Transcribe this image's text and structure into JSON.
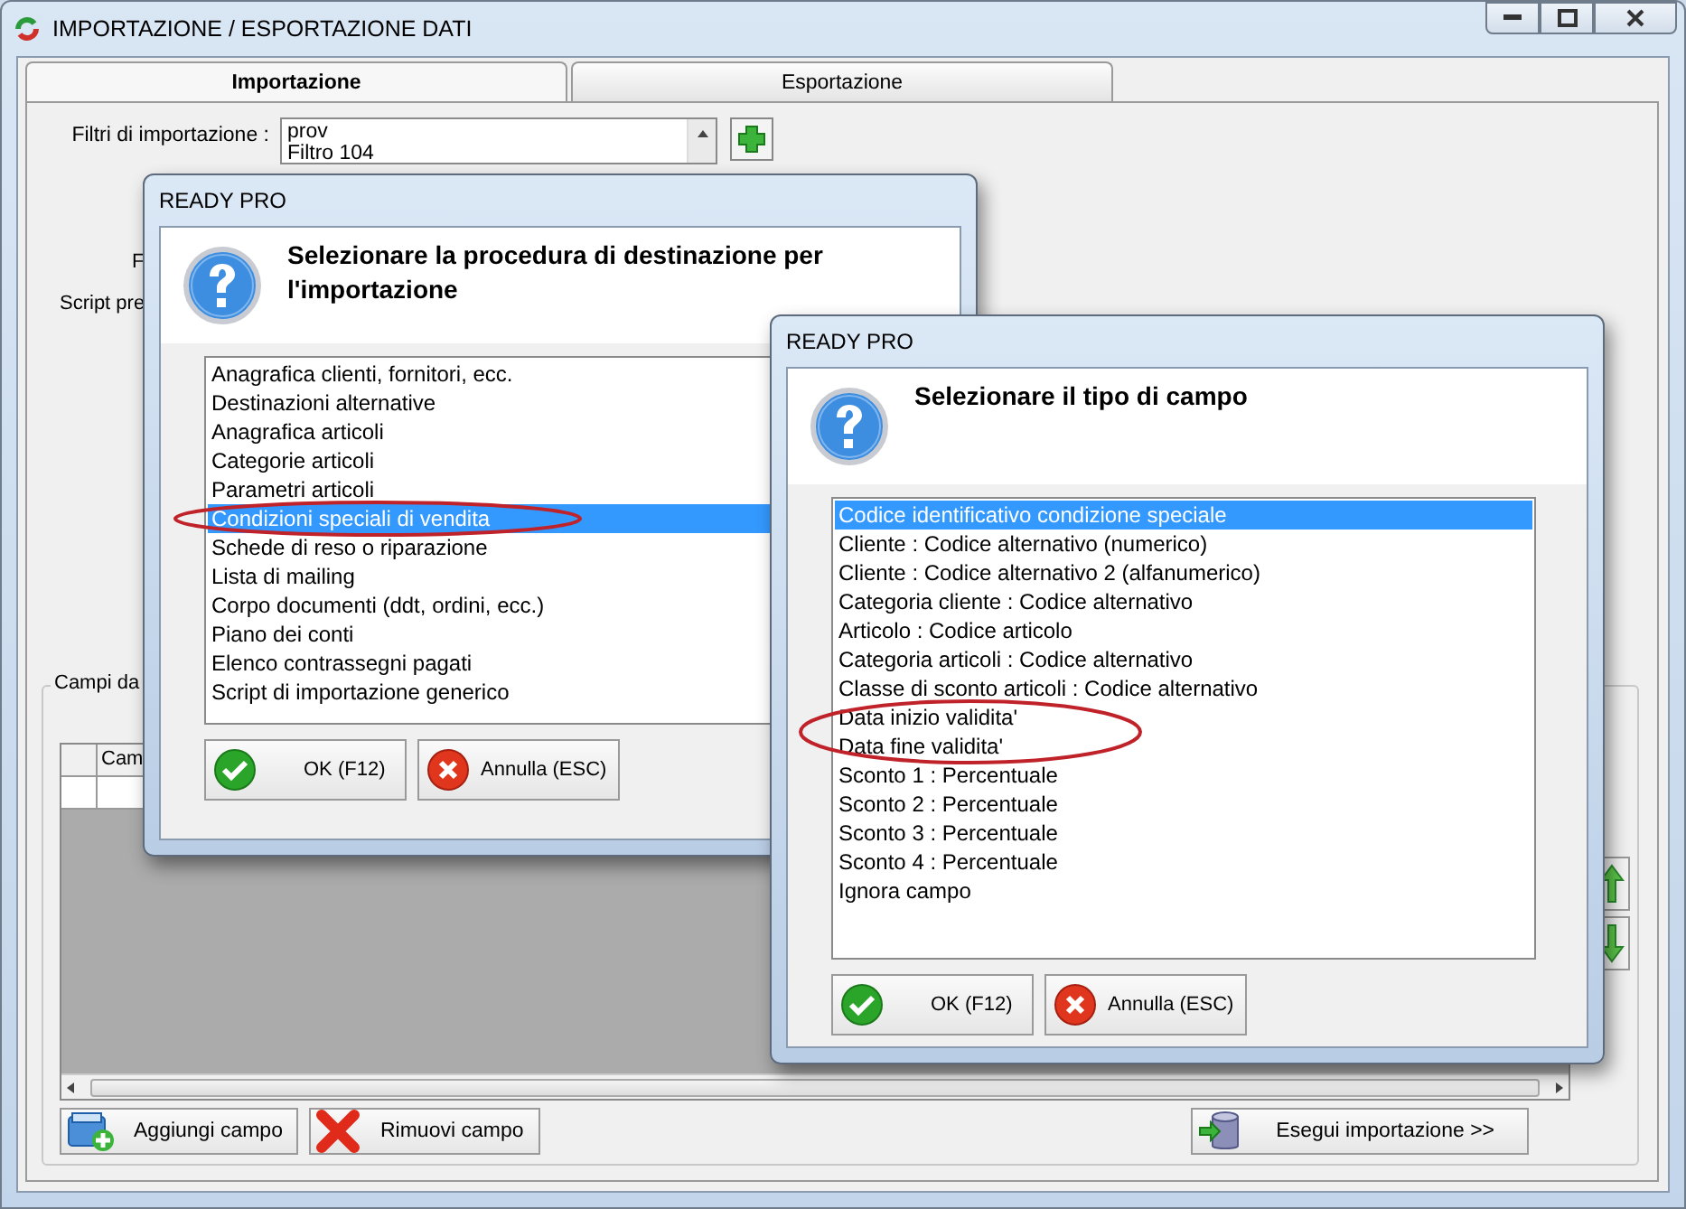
{
  "window": {
    "title": "IMPORTAZIONE / ESPORTAZIONE DATI"
  },
  "tabs": [
    {
      "label": "Importazione",
      "selected": true
    },
    {
      "label": "Esportazione",
      "selected": false
    }
  ],
  "filters": {
    "label": "Filtri di importazione :",
    "items": [
      "prov",
      "Filtro 104"
    ]
  },
  "side_labels": [
    "F",
    "Script pre"
  ],
  "fields_group": {
    "title": "Campi da",
    "columns": [
      "Cam"
    ]
  },
  "buttons": [
    {
      "label": "Aggiungi campo",
      "kind": "add"
    },
    {
      "label": "Rimuovi campo",
      "kind": "remove"
    },
    {
      "label": "Esegui importazione >>",
      "kind": "run"
    }
  ],
  "dialogs": [
    {
      "title": "READY PRO",
      "prompt": "Selezionare la procedura di destinazione per l'importazione",
      "options": [
        {
          "label": "Anagrafica clienti, fornitori, ecc.",
          "selected": false,
          "circled": false
        },
        {
          "label": "Destinazioni alternative",
          "selected": false,
          "circled": false
        },
        {
          "label": "Anagrafica articoli",
          "selected": false,
          "circled": false
        },
        {
          "label": "Categorie articoli",
          "selected": false,
          "circled": false
        },
        {
          "label": "Parametri articoli",
          "selected": false,
          "circled": false
        },
        {
          "label": "Condizioni speciali di vendita",
          "selected": true,
          "circled": true
        },
        {
          "label": "Schede di reso o riparazione",
          "selected": false,
          "circled": false
        },
        {
          "label": "Lista di mailing",
          "selected": false,
          "circled": false
        },
        {
          "label": "Corpo documenti (ddt, ordini, ecc.)",
          "selected": false,
          "circled": false
        },
        {
          "label": "Piano dei conti",
          "selected": false,
          "circled": false
        },
        {
          "label": "Elenco contrassegni pagati",
          "selected": false,
          "circled": false
        },
        {
          "label": "Script di importazione generico",
          "selected": false,
          "circled": false
        }
      ],
      "buttons": [
        {
          "label": "OK (F12)",
          "kind": "ok"
        },
        {
          "label": "Annulla (ESC)",
          "kind": "cancel"
        }
      ]
    },
    {
      "title": "READY PRO",
      "prompt": "Selezionare il tipo di campo",
      "options": [
        {
          "label": "Codice identificativo condizione speciale",
          "selected": true,
          "circled": false
        },
        {
          "label": "Cliente : Codice alternativo (numerico)",
          "selected": false,
          "circled": false
        },
        {
          "label": "Cliente : Codice alternativo 2 (alfanumerico)",
          "selected": false,
          "circled": false
        },
        {
          "label": "Categoria cliente : Codice alternativo",
          "selected": false,
          "circled": false
        },
        {
          "label": "Articolo : Codice articolo",
          "selected": false,
          "circled": false
        },
        {
          "label": "Categoria articoli : Codice alternativo",
          "selected": false,
          "circled": false
        },
        {
          "label": "Classe di sconto articoli : Codice alternativo",
          "selected": false,
          "circled": false
        },
        {
          "label": "Data inizio validita'",
          "selected": false,
          "circled": true
        },
        {
          "label": "Data fine validita'",
          "selected": false,
          "circled": true
        },
        {
          "label": "Sconto 1 : Percentuale",
          "selected": false,
          "circled": false
        },
        {
          "label": "Sconto 2 : Percentuale",
          "selected": false,
          "circled": false
        },
        {
          "label": "Sconto 3 : Percentuale",
          "selected": false,
          "circled": false
        },
        {
          "label": "Sconto 4 : Percentuale",
          "selected": false,
          "circled": false
        },
        {
          "label": "Ignora campo",
          "selected": false,
          "circled": false
        }
      ],
      "buttons": [
        {
          "label": "OK (F12)",
          "kind": "ok"
        },
        {
          "label": "Annulla (ESC)",
          "kind": "cancel"
        }
      ]
    }
  ]
}
